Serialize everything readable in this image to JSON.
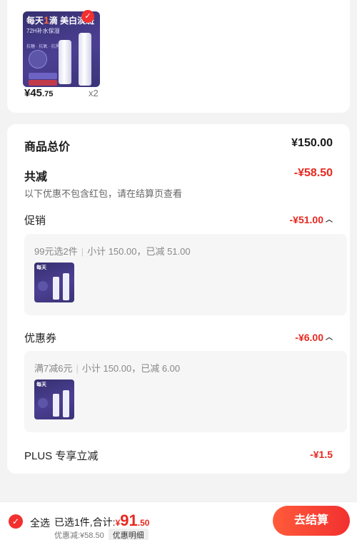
{
  "product": {
    "thumb_title_a": "每天",
    "thumb_title_num": "1",
    "thumb_title_b": "滴  美白淡斑",
    "thumb_subtitle": "72H补水保湿",
    "thumb_features": "抗糖 · 抗氧 · 抗黑气",
    "price_main": "¥45",
    "price_decimal": ".75",
    "quantity": "x2"
  },
  "summary": {
    "total_label": "商品总价",
    "total_value": "¥150.00",
    "reduction_label": "共减",
    "reduction_value": "-¥58.50",
    "reduction_hint": "以下优惠不包含红包，请在结算页查看"
  },
  "promotion": {
    "label": "促销",
    "value": "-¥51.00",
    "rule": "99元选2件",
    "detail": "小计 150.00，已减 51.00"
  },
  "coupon": {
    "label": "优惠券",
    "value": "-¥6.00",
    "rule": "满7减6元",
    "detail": "小计 150.00，已减 6.00"
  },
  "plus": {
    "label": "PLUS 专享立减",
    "value": "-¥1.5"
  },
  "bottom_bar": {
    "select_all": "全选",
    "selected_text": "已选1件,合计:",
    "total_currency": "¥",
    "total_int": "91",
    "total_dec": ".50",
    "discount_text": "优惠减:¥58.50",
    "detail_button": "优惠明细",
    "checkout_button": "去结算"
  }
}
